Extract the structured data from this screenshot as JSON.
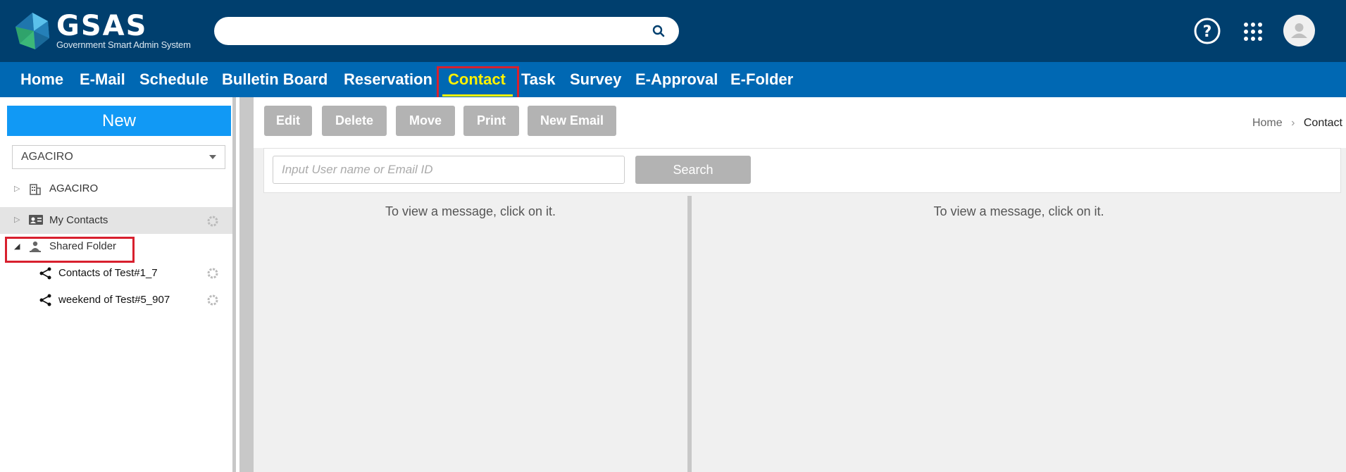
{
  "app": {
    "logo_big": "GSAS",
    "logo_small": "Government Smart Admin System"
  },
  "header": {
    "search_value": "",
    "icons": [
      "search-icon",
      "help-icon",
      "apps-grid-icon",
      "user-avatar-icon"
    ]
  },
  "nav": {
    "items": [
      {
        "label": "Home"
      },
      {
        "label": "E-Mail"
      },
      {
        "label": "Schedule"
      },
      {
        "label": "Bulletin Board"
      },
      {
        "label": "Reservation"
      },
      {
        "label": "Contact",
        "active": true
      },
      {
        "label": "Task"
      },
      {
        "label": "Survey"
      },
      {
        "label": "E-Approval"
      },
      {
        "label": "E-Folder"
      }
    ],
    "active_color": "#fff200"
  },
  "sidebar": {
    "new_label": "New",
    "org_select": "AGACIRO",
    "tree": [
      {
        "label": "AGACIRO",
        "icon": "building-icon",
        "expanded": false
      },
      {
        "label": "My Contacts",
        "icon": "contact-card-icon",
        "expanded": false,
        "selected": true
      },
      {
        "label": "Shared Folder",
        "icon": "shared-folder-icon",
        "expanded": true
      },
      {
        "label": "Contacts of Test#1_7",
        "icon": "share-icon",
        "child": true
      },
      {
        "label": "weekend of Test#5_907",
        "icon": "share-icon",
        "child": true
      }
    ]
  },
  "toolbar": {
    "edit": "Edit",
    "delete": "Delete",
    "move": "Move",
    "print": "Print",
    "new_email": "New Email"
  },
  "breadcrumb": {
    "home": "Home",
    "current": "Contact"
  },
  "search": {
    "placeholder": "Input User name or Email ID",
    "button": "Search"
  },
  "panes": {
    "left_message": "To view a message, click on it.",
    "right_message": "To view a message, click on it."
  },
  "colors": {
    "topbar": "#003f6e",
    "navbar": "#0068b3",
    "new_button": "#1199f5",
    "highlight": "#d8202e"
  }
}
